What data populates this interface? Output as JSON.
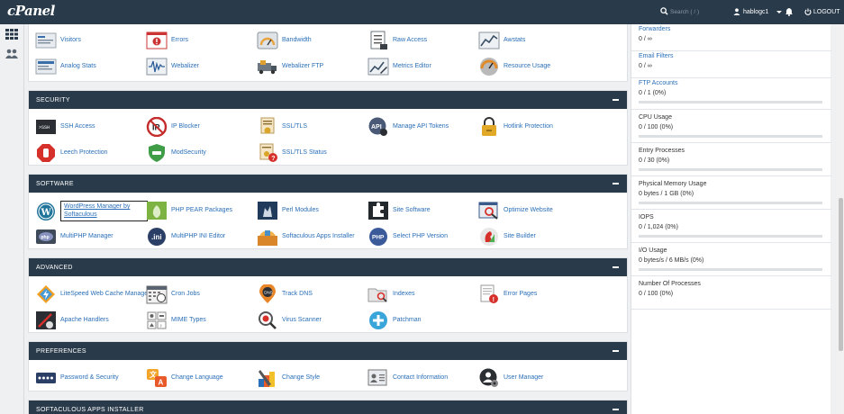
{
  "header": {
    "logo": "cPanel",
    "search_placeholder": "Search ( / )",
    "username": "hablogc1",
    "logout_label": "LOGOUT"
  },
  "metrics_items": [
    {
      "label": "Visitors",
      "icon": "visitors-icon"
    },
    {
      "label": "Errors",
      "icon": "errors-icon"
    },
    {
      "label": "Bandwidth",
      "icon": "bandwidth-icon"
    },
    {
      "label": "Raw Access",
      "icon": "raw-access-icon"
    },
    {
      "label": "Awstats",
      "icon": "awstats-icon"
    },
    {
      "label": "Analog Stats",
      "icon": "analog-stats-icon"
    },
    {
      "label": "Webalizer",
      "icon": "webalizer-icon"
    },
    {
      "label": "Webalizer FTP",
      "icon": "webalizer-ftp-icon"
    },
    {
      "label": "Metrics Editor",
      "icon": "metrics-editor-icon"
    },
    {
      "label": "Resource Usage",
      "icon": "resource-usage-icon"
    }
  ],
  "security": {
    "title": "SECURITY",
    "items": [
      {
        "label": "SSH Access",
        "icon": "ssh-icon"
      },
      {
        "label": "IP Blocker",
        "icon": "ip-blocker-icon"
      },
      {
        "label": "SSL/TLS",
        "icon": "ssl-icon"
      },
      {
        "label": "Manage API Tokens",
        "icon": "api-icon"
      },
      {
        "label": "Hotlink Protection",
        "icon": "lock-icon"
      },
      {
        "label": "Leech Protection",
        "icon": "stop-hand-icon"
      },
      {
        "label": "ModSecurity",
        "icon": "shield-icon"
      },
      {
        "label": "SSL/TLS Status",
        "icon": "ssl-status-icon"
      }
    ]
  },
  "software": {
    "title": "SOFTWARE",
    "items": [
      {
        "label": "WordPress Manager by Softaculous",
        "icon": "wordpress-icon"
      },
      {
        "label": "PHP PEAR Packages",
        "icon": "pear-icon"
      },
      {
        "label": "Perl Modules",
        "icon": "perl-icon"
      },
      {
        "label": "Site Software",
        "icon": "puzzle-icon"
      },
      {
        "label": "Optimize Website",
        "icon": "optimize-icon"
      },
      {
        "label": "MultiPHP Manager",
        "icon": "php-manager-icon"
      },
      {
        "label": "MultiPHP INI Editor",
        "icon": "ini-icon"
      },
      {
        "label": "Softaculous Apps Installer",
        "icon": "softaculous-icon"
      },
      {
        "label": "Select PHP Version",
        "icon": "php-version-icon"
      },
      {
        "label": "Site Builder",
        "icon": "site-builder-icon"
      }
    ]
  },
  "advanced": {
    "title": "ADVANCED",
    "items": [
      {
        "label": "LiteSpeed Web Cache Manager",
        "icon": "litespeed-icon"
      },
      {
        "label": "Cron Jobs",
        "icon": "cron-icon"
      },
      {
        "label": "Track DNS",
        "icon": "dns-icon"
      },
      {
        "label": "Indexes",
        "icon": "indexes-icon"
      },
      {
        "label": "Error Pages",
        "icon": "error-pages-icon"
      },
      {
        "label": "Apache Handlers",
        "icon": "apache-icon"
      },
      {
        "label": "MIME Types",
        "icon": "mime-icon"
      },
      {
        "label": "Virus Scanner",
        "icon": "virus-icon"
      },
      {
        "label": "Patchman",
        "icon": "patchman-icon"
      }
    ]
  },
  "preferences": {
    "title": "PREFERENCES",
    "items": [
      {
        "label": "Password & Security",
        "icon": "password-icon"
      },
      {
        "label": "Change Language",
        "icon": "language-icon"
      },
      {
        "label": "Change Style",
        "icon": "style-icon"
      },
      {
        "label": "Contact Information",
        "icon": "contact-icon"
      },
      {
        "label": "User Manager",
        "icon": "user-manager-icon"
      }
    ]
  },
  "softaculous": {
    "title": "SOFTACULOUS APPS INSTALLER"
  },
  "stats": [
    {
      "title": "Forwarders",
      "value": "0 / ∞",
      "link": true,
      "bar": false
    },
    {
      "title": "Email Filters",
      "value": "0 / ∞",
      "link": true,
      "bar": false
    },
    {
      "title": "FTP Accounts",
      "value": "0 / 1   (0%)",
      "link": true,
      "bar": true
    },
    {
      "title": "CPU Usage",
      "value": "0 / 100   (0%)",
      "link": false,
      "bar": true
    },
    {
      "title": "Entry Processes",
      "value": "0 / 30   (0%)",
      "link": false,
      "bar": true
    },
    {
      "title": "Physical Memory Usage",
      "value": "0 bytes / 1 GB   (0%)",
      "link": false,
      "bar": true
    },
    {
      "title": "IOPS",
      "value": "0 / 1,024   (0%)",
      "link": false,
      "bar": true
    },
    {
      "title": "I/O Usage",
      "value": "0 bytes/s / 6 MB/s   (0%)",
      "link": false,
      "bar": true
    },
    {
      "title": "Number Of Processes",
      "value": "0 / 100   (0%)",
      "link": false,
      "bar": true
    }
  ],
  "colors": {
    "header_bg": "#293a4a",
    "link": "#2a6fb8"
  }
}
